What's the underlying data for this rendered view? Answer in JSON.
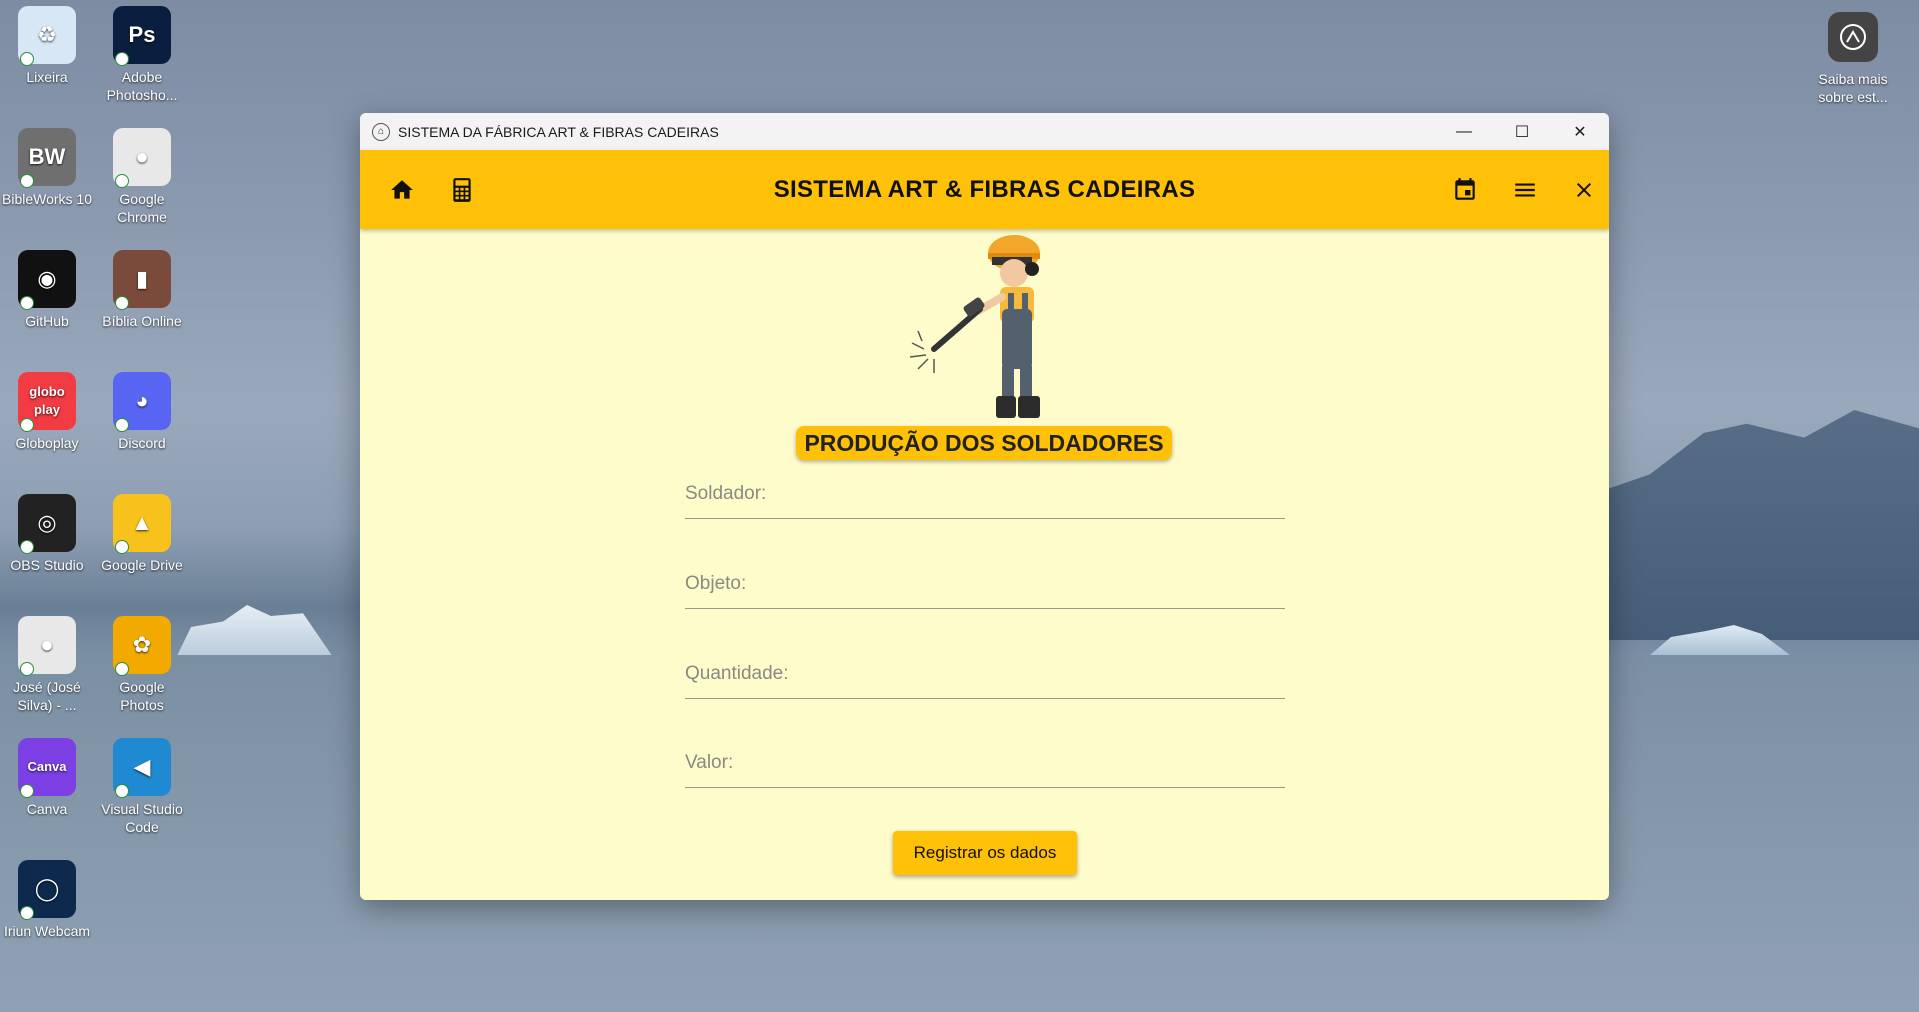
{
  "desktop": {
    "icons": [
      {
        "label": "Lixeira",
        "glyph": "♻",
        "color": "#d8e7f5"
      },
      {
        "label": "Adobe Photosho...",
        "glyph": "Ps",
        "color": "#0a1e3f"
      },
      {
        "label": "BibleWorks 10",
        "glyph": "BW",
        "color": "#6f6f6f"
      },
      {
        "label": "Google Chrome",
        "glyph": "●",
        "color": "#e8e8e8"
      },
      {
        "label": "GitHub",
        "glyph": "◉",
        "color": "#111111"
      },
      {
        "label": "Bíblia Online",
        "glyph": "▮",
        "color": "#7a4a3a"
      },
      {
        "label": "Globoplay",
        "glyph": "globo play",
        "color": "#f23b43"
      },
      {
        "label": "Discord",
        "glyph": "◕",
        "color": "#5865f2"
      },
      {
        "label": "OBS Studio",
        "glyph": "◎",
        "color": "#222222"
      },
      {
        "label": "Google Drive",
        "glyph": "▲",
        "color": "#f7c21b"
      },
      {
        "label": "José (José Silva) - ...",
        "glyph": "●",
        "color": "#e8e8e8"
      },
      {
        "label": "Google Photos",
        "glyph": "✿",
        "color": "#f2a900"
      },
      {
        "label": "Canva",
        "glyph": "Canva",
        "color": "#7b3fe4"
      },
      {
        "label": "Visual Studio Code",
        "glyph": "◀",
        "color": "#1f8ad2"
      },
      {
        "label": "Iriun Webcam",
        "glyph": "◯",
        "color": "#0d2a4e"
      }
    ],
    "saiba_label": "Saiba mais sobre est..."
  },
  "window": {
    "title": "SISTEMA DA FÁBRICA ART & FIBRAS CADEIRAS",
    "controls": {
      "minimize": "—",
      "maximize": "☐",
      "close": "✕"
    }
  },
  "appbar": {
    "title": "SISTEMA ART & FIBRAS CADEIRAS"
  },
  "form": {
    "section_title": "PRODUÇÃO DOS SOLDADORES",
    "fields": [
      {
        "placeholder": "Soldador:",
        "value": ""
      },
      {
        "placeholder": "Objeto:",
        "value": ""
      },
      {
        "placeholder": "Quantidade:",
        "value": ""
      },
      {
        "placeholder": "Valor:",
        "value": ""
      }
    ],
    "submit_label": "Registrar os dados"
  }
}
